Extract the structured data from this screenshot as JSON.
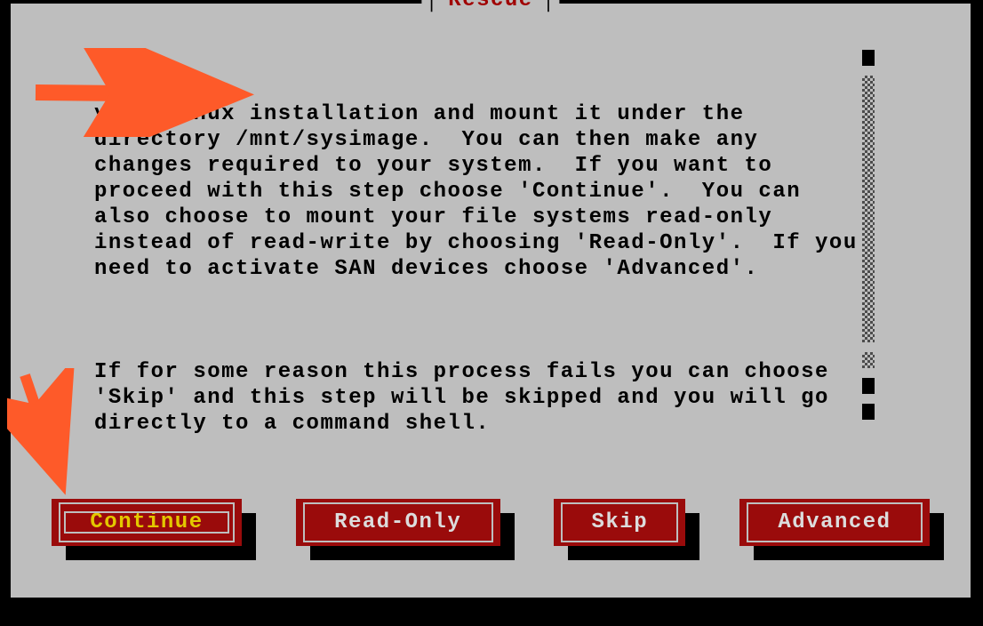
{
  "colors": {
    "accent": "#a00000",
    "panel": "#bebebe",
    "button": "#9a0b0b",
    "arrow": "#fe5a29",
    "focused": "#e3c800"
  },
  "dialog": {
    "title": "Rescue",
    "paragraph1": "your Linux installation and mount it under the directory /mnt/sysimage.  You can then make any changes required to your system.  If you want to proceed with this step choose 'Continue'.  You can also choose to mount your file systems read-only instead of read-write by choosing 'Read-Only'.  If you need to activate SAN devices choose 'Advanced'.",
    "paragraph2": "If for some reason this process fails you can choose 'Skip' and this step will be skipped and you will go directly to a command shell."
  },
  "buttons": {
    "continue": "Continue",
    "readonly": "Read-Only",
    "skip": "Skip",
    "advanced": "Advanced"
  },
  "annotations": {
    "arrow1": "arrow-to-text",
    "arrow2": "arrow-to-continue"
  }
}
